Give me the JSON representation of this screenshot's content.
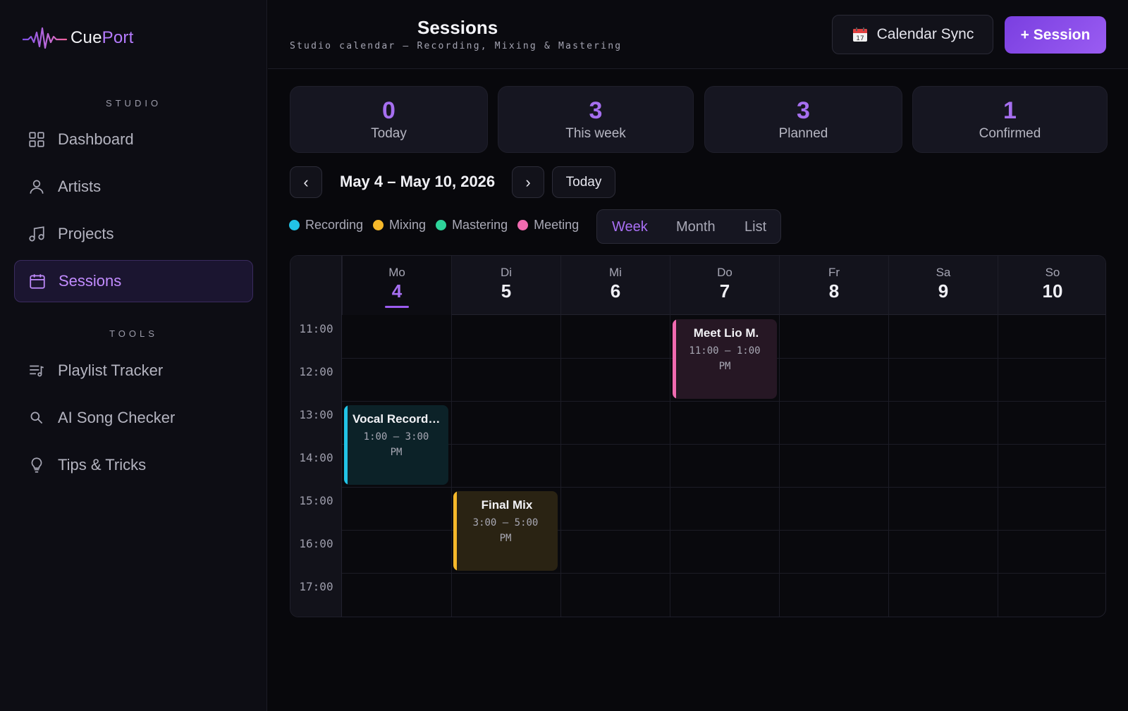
{
  "app": {
    "name_part1": "Cue",
    "name_part2": "Port"
  },
  "sidebar": {
    "studio_label": "STUDIO",
    "tools_label": "TOOLS",
    "studio_items": [
      {
        "label": "Dashboard",
        "icon": "grid-icon"
      },
      {
        "label": "Artists",
        "icon": "user-icon"
      },
      {
        "label": "Projects",
        "icon": "music-note-icon"
      },
      {
        "label": "Sessions",
        "icon": "calendar-icon",
        "active": true
      }
    ],
    "tool_items": [
      {
        "label": "Playlist Tracker",
        "icon": "playlist-icon"
      },
      {
        "label": "AI Song Checker",
        "icon": "search-icon"
      },
      {
        "label": "Tips & Tricks",
        "icon": "lightbulb-icon"
      }
    ]
  },
  "header": {
    "title": "Sessions",
    "subtitle": "Studio calendar — Recording, Mixing & Mastering",
    "sync_label": "Calendar Sync",
    "add_label": "+ Session"
  },
  "stats": [
    {
      "value": "0",
      "label": "Today"
    },
    {
      "value": "3",
      "label": "This week"
    },
    {
      "value": "3",
      "label": "Planned"
    },
    {
      "value": "1",
      "label": "Confirmed"
    }
  ],
  "week_nav": {
    "prev": "‹",
    "next": "›",
    "range": "May 4 – May 10, 2026",
    "today_label": "Today"
  },
  "legend": [
    {
      "label": "Recording",
      "color": "#22c3e6"
    },
    {
      "label": "Mixing",
      "color": "#f5b82a"
    },
    {
      "label": "Mastering",
      "color": "#2ed39a"
    },
    {
      "label": "Meeting",
      "color": "#f06bb0"
    }
  ],
  "views": {
    "week": "Week",
    "month": "Month",
    "list": "List",
    "active": "week"
  },
  "calendar": {
    "days": [
      {
        "name": "Mo",
        "num": "4",
        "today": true
      },
      {
        "name": "Di",
        "num": "5"
      },
      {
        "name": "Mi",
        "num": "6"
      },
      {
        "name": "Do",
        "num": "7"
      },
      {
        "name": "Fr",
        "num": "8"
      },
      {
        "name": "Sa",
        "num": "9"
      },
      {
        "name": "So",
        "num": "10"
      }
    ],
    "hours": [
      "11:00",
      "12:00",
      "13:00",
      "14:00",
      "15:00",
      "16:00",
      "17:00"
    ],
    "events": [
      {
        "title": "Meet Lio M.",
        "time_line1": "11:00 – 1:00",
        "time_line2": "PM",
        "type": "Meeting",
        "color": "#f06bb0",
        "bg": "#261724"
      },
      {
        "title": "Vocal Recording",
        "time_line1": "1:00 – 3:00",
        "time_line2": "PM",
        "type": "Recording",
        "color": "#22c3e6",
        "bg": "#0c2228"
      },
      {
        "title": "Final Mix",
        "time_line1": "3:00 – 5:00",
        "time_line2": "PM",
        "type": "Mixing",
        "color": "#f5b82a",
        "bg": "#2a2313"
      }
    ]
  }
}
